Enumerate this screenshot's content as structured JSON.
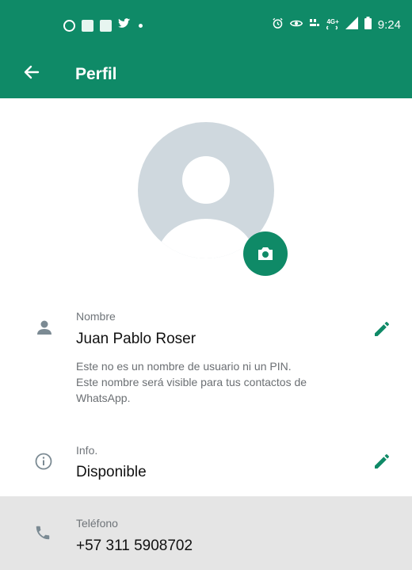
{
  "status_bar": {
    "notification_icons": [
      "facebook-icon",
      "app-icon",
      "app-icon",
      "twitter-icon",
      "dot-icon"
    ],
    "system_icons": [
      "alarm-icon",
      "eye-icon",
      "volte-icon",
      "4g-icon",
      "signal-icon",
      "battery-icon"
    ],
    "net_top": "4G+",
    "time": "9:24"
  },
  "toolbar": {
    "title": "Perfil"
  },
  "profile": {
    "name_label": "Nombre",
    "name_value": "Juan Pablo Roser",
    "name_hint_line1": "Este no es un nombre de usuario ni un PIN.",
    "name_hint_line2": "Este nombre será visible para tus contactos de",
    "name_hint_line3": "WhatsApp.",
    "info_label": "Info.",
    "info_value": "Disponible",
    "phone_label": "Teléfono",
    "phone_value": "+57 311 5908702"
  },
  "colors": {
    "accent": "#0f8a67",
    "avatar_bg": "#cfd8de",
    "avatar_fg": "#ffffff",
    "icon_gray": "#7b8a93"
  }
}
